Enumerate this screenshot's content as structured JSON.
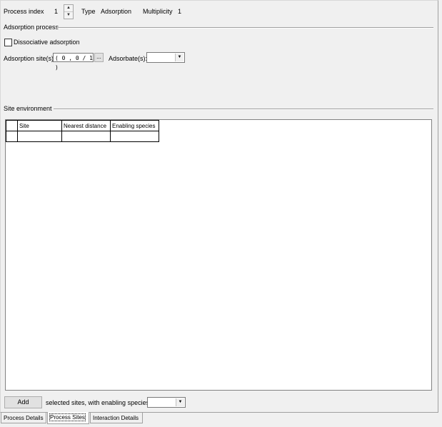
{
  "header": {
    "process_index_label": "Process index",
    "process_index_value": "1",
    "type_label": "Type",
    "type_value": "Adsorption",
    "multiplicity_label": "Multiplicity",
    "multiplicity_value": "1"
  },
  "adsorption": {
    "group_title": "Adsorption process",
    "dissociative_label": "Dissociative adsorption",
    "dissociative_checked": false,
    "sites_label": "Adsorption site(s):",
    "sites_value": "( 0 , 0 / 1 )",
    "sites_button": "...",
    "adsorbate_label": "Adsorbate(s):",
    "adsorbate_value": ""
  },
  "site_env": {
    "group_title": "Site environment",
    "columns": [
      "Site",
      "Nearest distance",
      "Enabling species"
    ],
    "rows": [
      [
        "",
        "",
        ""
      ]
    ]
  },
  "footer": {
    "add_button": "Add",
    "selected_text": "selected sites, with enabling species",
    "species_value": ""
  },
  "tabs": [
    {
      "label": "Process Details",
      "active": false
    },
    {
      "label": "Process Sites",
      "active": true
    },
    {
      "label": "Interaction Details",
      "active": false
    }
  ]
}
